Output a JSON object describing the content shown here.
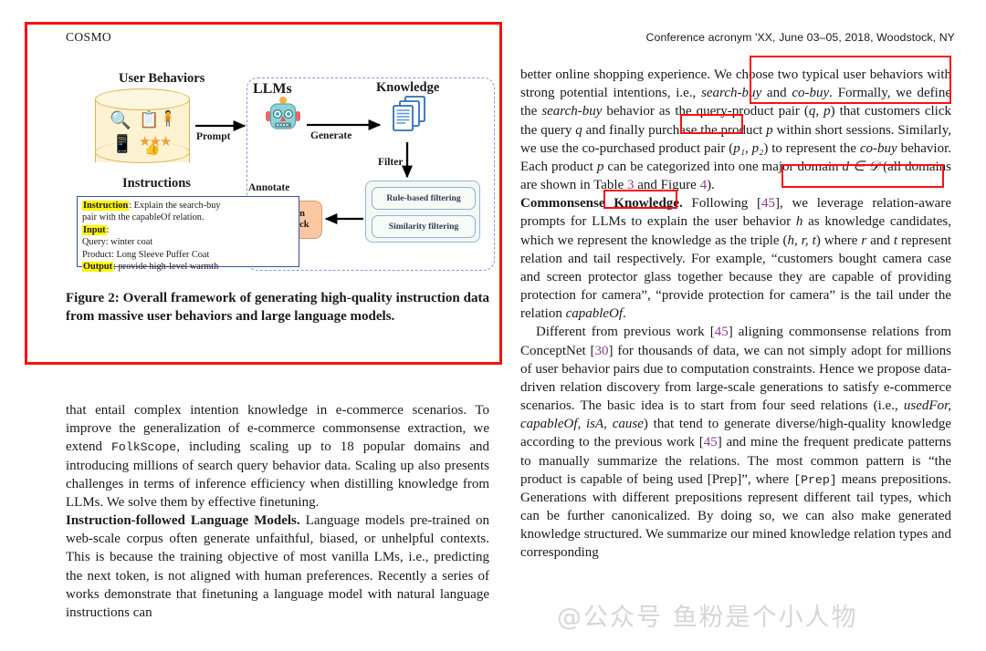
{
  "header": {
    "left": "COSMO",
    "right": "Conference acronym 'XX, June 03–05, 2018, Woodstock, NY"
  },
  "figure": {
    "labels": {
      "user_behaviors": "User Behaviors",
      "llms": "LLMs",
      "knowledge": "Knowledge",
      "instructions": "Instructions"
    },
    "arrows": {
      "prompt": "Prompt",
      "generate": "Generate",
      "filter": "Filter",
      "annotate": "Annotate"
    },
    "filters": [
      "Rule-based filtering",
      "Similarity filtering"
    ],
    "human_feedback": {
      "line1": "Human",
      "line2": "Feedback"
    },
    "instruction_box": {
      "l1_key": "Instruction",
      "l1_val": ": Explain the search-buy",
      "l2": "pair with the capableOf relation.",
      "l3_key": "Input",
      "l3_val": ":",
      "l4": "Query:  winter coat",
      "l5": "Product:  Long Sleeve Puffer Coat",
      "l6_key": "Output",
      "l6_val": ":  provide high-level warmth"
    },
    "cylinder_icons": {
      "search": "🔍",
      "list": "📋",
      "person": "🧍",
      "phone": "📱",
      "stars": "★★★",
      "thumb": "👍"
    },
    "caption": "Figure 2: Overall framework of generating high-quality instruction data from massive user behaviors and large language models."
  },
  "left_column": {
    "para1": "that entail complex intention knowledge in e-commerce scenarios. To improve the generalization of e-commerce commonsense extraction, we extend ",
    "para1_mono": "FolkScope",
    "para1_cont": ", including scaling up to 18 popular domains and introducing millions of search query behavior data. Scaling up also presents challenges in terms of inference efficiency when distilling knowledge from LLMs. We solve them by effective finetuning.",
    "para2_head": "Instruction-followed Language Models.",
    "para2": " Language models pre-trained on web-scale corpus often generate unfaithful, biased, or unhelpful contexts. This is because the training objective of most vanilla LMs, i.e., predicting the next token, is not aligned with human preferences. Recently a series of works demonstrate that finetuning a language model with natural language instructions can"
  },
  "right_column": {
    "para1_a": "better online shopping experience. We choose two typical user behaviors with strong potential intentions, i.e., ",
    "para1_i1": "search-buy",
    "para1_b": " and ",
    "para1_i2": "co-buy",
    "para1_c": ". Formally, we define the ",
    "para1_i3": "search-buy",
    "para1_d": " behavior as the query-product pair (",
    "para1_q": "q, p",
    "para1_e": ") that customers click the query ",
    "para1_f": "q",
    "para1_g": " and finally purchase the product ",
    "para1_h": "p",
    "para1_i": " within short sessions. Similarly, we use the co-purchased product pair (",
    "para1_p12": "p₁, p₂",
    "para1_j": ") to represent the ",
    "para1_i4": "co-buy",
    "para1_k": " behavior. Each product ",
    "para1_l": "p",
    "para1_m": " can be categorized into one major domain ",
    "para1_d2": "d ∈ 𝒟",
    "para1_n": " (all domains are shown in Table ",
    "para1_ref1": "3",
    "para1_o": " and Figure ",
    "para1_ref2": "4",
    "para1_p": ").",
    "para2_head": "Commonsense Knowledge.",
    "para2_a": " Following [",
    "para2_ref": "45",
    "para2_b": "], we leverage relation-aware prompts for LLMs to explain the user behavior ",
    "para2_h": "h",
    "para2_c": " as knowledge candidates, which we represent the knowledge as the triple (",
    "para2_hrt": "h, r, t",
    "para2_d": ") where ",
    "para2_r": "r",
    "para2_e": " and ",
    "para2_t": "t",
    "para2_f": " represent relation and tail respectively. For example, “customers bought camera case and screen protector glass together because they are capable of providing protection for camera”, “provide protection for camera” is the tail under the relation ",
    "para2_cap": "capableOf",
    "para2_g": ".",
    "para3_a": "Different from previous work [",
    "para3_ref1": "45",
    "para3_b": "] aligning commonsense relations from ConceptNet [",
    "para3_ref2": "30",
    "para3_c": "] for thousands of data, we can not simply adopt for millions of user behavior pairs due to computation constraints. Hence we propose data-driven relation discovery from large-scale generations to satisfy e-commerce scenarios. The basic idea is to start from four seed relations (i.e., ",
    "para3_i1": "usedFor, capableOf, isA, cause",
    "para3_d": ") that tend to generate diverse/high-quality knowledge according to the previous work [",
    "para3_ref3": "45",
    "para3_e": "] and mine the frequent predicate patterns to manually summarize the relations. The most common pattern is “the product is capable of being used [Prep]”, where ",
    "para3_mono": "[Prep]",
    "para3_f": " means prepositions. Generations with different prepositions represent different tail types, which can be further canonicalized. By doing so, we can also make generated knowledge structured. We summarize our mined knowledge relation types and corresponding"
  },
  "annotations": {
    "color": "#fb0f0f",
    "boxes": [
      "figure-region",
      "we-choose-two-typical-user-be",
      "search-buy",
      "co-buy-behavior",
      "categorized"
    ]
  },
  "watermark": {
    "text": "@公众号 鱼粉是个小人物"
  }
}
